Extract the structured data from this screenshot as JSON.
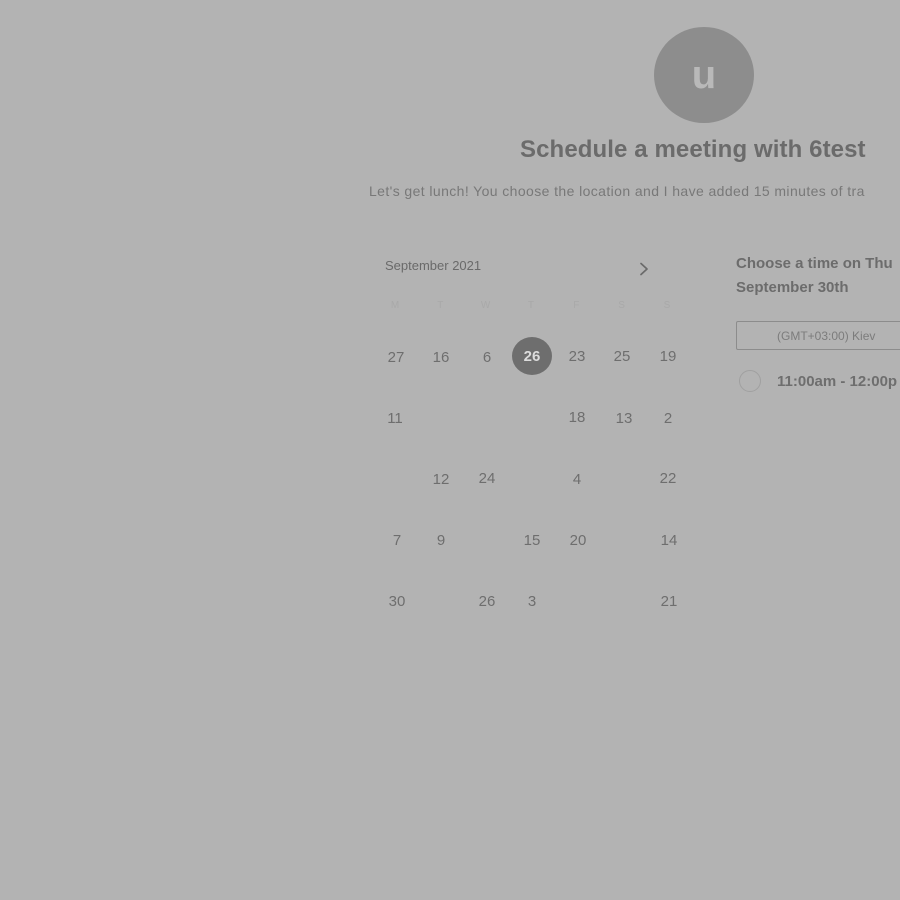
{
  "host": {
    "avatar_letter": "u",
    "title": "Schedule a meeting with 6test",
    "description": "Let's get lunch! You choose the location and I have added 15 minutes of tra"
  },
  "calendar": {
    "month_label": "September 2021",
    "next_icon": "chevron-right-icon",
    "weekdays": [
      "M",
      "T",
      "W",
      "T",
      "F",
      "S",
      "S"
    ],
    "selected_day": "26",
    "days": [
      "27",
      "16",
      "6",
      "26",
      "23",
      "25",
      "19",
      "11",
      "18",
      "13",
      "2",
      "12",
      "24",
      "4",
      "22",
      "7",
      "9",
      "15",
      "20",
      "14",
      "30",
      "26",
      "3",
      "21"
    ]
  },
  "times": {
    "heading_line1": "Choose a time on Thu",
    "heading_line2": "September 30th",
    "timezone": "(GMT+03:00) Kiev",
    "slot_label": "11:00am - 12:00p"
  },
  "colors": {
    "background": "#b3b3b3",
    "selected_day": "#6e6e6e",
    "avatar": "#8d8d8d"
  }
}
